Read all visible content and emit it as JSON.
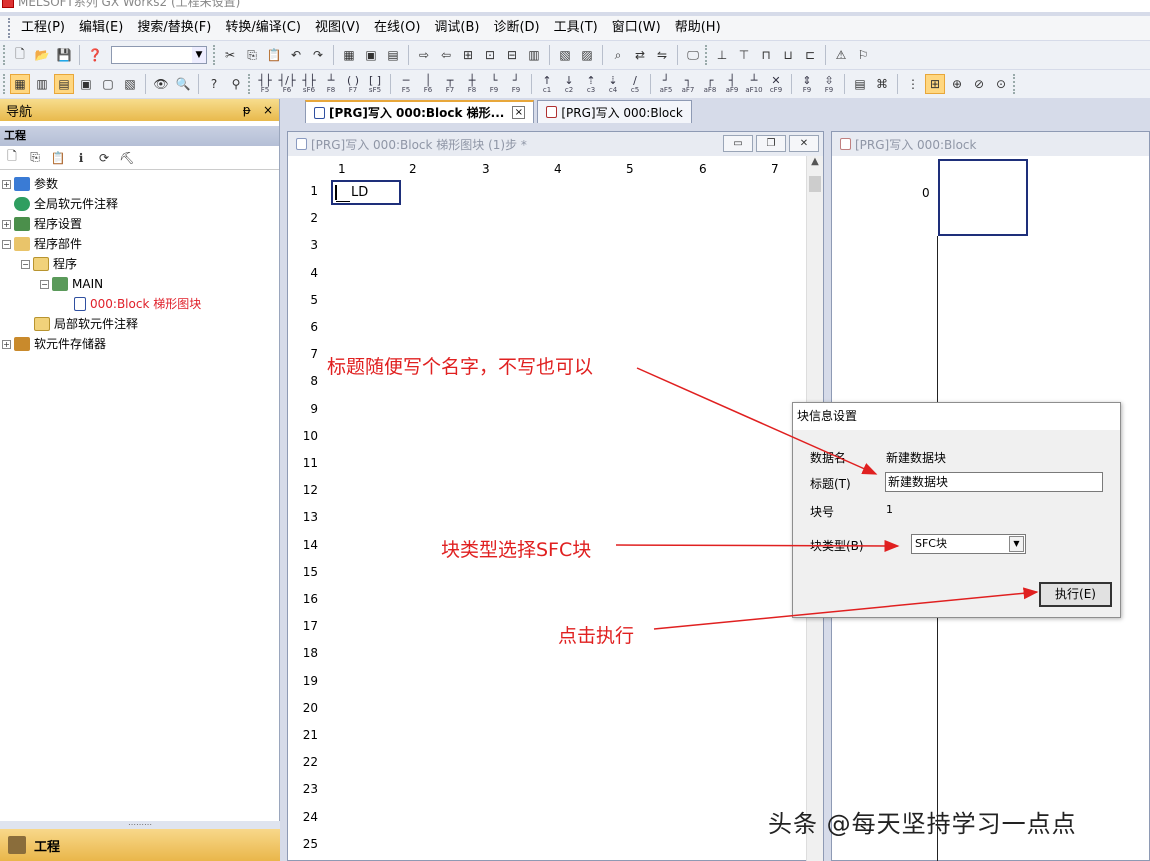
{
  "window": {
    "title": "MELSOFT系列 GX Works2 (工程未设置)"
  },
  "menu": [
    "工程(P)",
    "编辑(E)",
    "搜索/替换(F)",
    "转换/编译(C)",
    "视图(V)",
    "在线(O)",
    "调试(B)",
    "诊断(D)",
    "工具(T)",
    "窗口(W)",
    "帮助(H)"
  ],
  "toolbar_keys": [
    "F5",
    "F6",
    "sF6",
    "F8",
    "F7",
    "sF5",
    "F5",
    "F6",
    "F7",
    "F8",
    "F9",
    "F9",
    "c1",
    "c2",
    "c3",
    "c4",
    "c5",
    "aF5",
    "aF7",
    "aF8",
    "aF9",
    "aF10",
    "cF9",
    "F9",
    "F9"
  ],
  "navigation": {
    "title": "导航",
    "pin": "ᵽ",
    "close": "×",
    "section": "工程",
    "tree": [
      {
        "label": "参数",
        "indent": 0,
        "expander": "+"
      },
      {
        "label": "全局软元件注释",
        "indent": 0,
        "expander": ""
      },
      {
        "label": "程序设置",
        "indent": 0,
        "expander": "+"
      },
      {
        "label": "程序部件",
        "indent": 0,
        "expander": "−"
      },
      {
        "label": "程序",
        "indent": 1,
        "expander": "−"
      },
      {
        "label": "MAIN",
        "indent": 2,
        "expander": "−"
      },
      {
        "label": "000:Block 梯形图块",
        "indent": 3,
        "expander": "",
        "active": true
      },
      {
        "label": "局部软元件注释",
        "indent": 1,
        "expander": ""
      },
      {
        "label": "软元件存储器",
        "indent": 0,
        "expander": "+"
      }
    ],
    "footer_tab": "工程"
  },
  "tabs": [
    {
      "label": "[PRG]写入 000:Block 梯形...",
      "active": true
    },
    {
      "label": "[PRG]写入 000:Block",
      "active": false
    }
  ],
  "editor": {
    "title": "[PRG]写入 000:Block 梯形图块 (1)步 *",
    "columns": [
      "1",
      "2",
      "3",
      "4",
      "5",
      "6",
      "7"
    ],
    "rows": [
      "1",
      "2",
      "3",
      "4",
      "5",
      "6",
      "7",
      "8",
      "9",
      "10",
      "11",
      "12",
      "13",
      "14",
      "15",
      "16",
      "17",
      "18",
      "19",
      "20",
      "21",
      "22",
      "23",
      "24",
      "25"
    ],
    "cell_text": "LD"
  },
  "sfc": {
    "title": "[PRG]写入 000:Block",
    "step": "0"
  },
  "dialog": {
    "title": "块信息设置",
    "data_name_label": "数据名",
    "data_name_value": "新建数据块",
    "title_label": "标题(T)",
    "title_value": "新建数据块",
    "block_no_label": "块号",
    "block_no_value": "1",
    "block_type_label": "块类型(B)",
    "block_type_value": "SFC块",
    "execute_label": "执行(E)"
  },
  "annotations": {
    "title_hint": "标题随便写个名字，不写也可以",
    "type_hint": "块类型选择SFC块",
    "exec_hint": "点击执行"
  },
  "watermark": "头条 @每天坚持学习一点点",
  "colors": {
    "accent": "#e8a73a",
    "annotation": "#e02020",
    "cursor": "#1e2f7a",
    "active_tree_item": "#e0202a"
  }
}
